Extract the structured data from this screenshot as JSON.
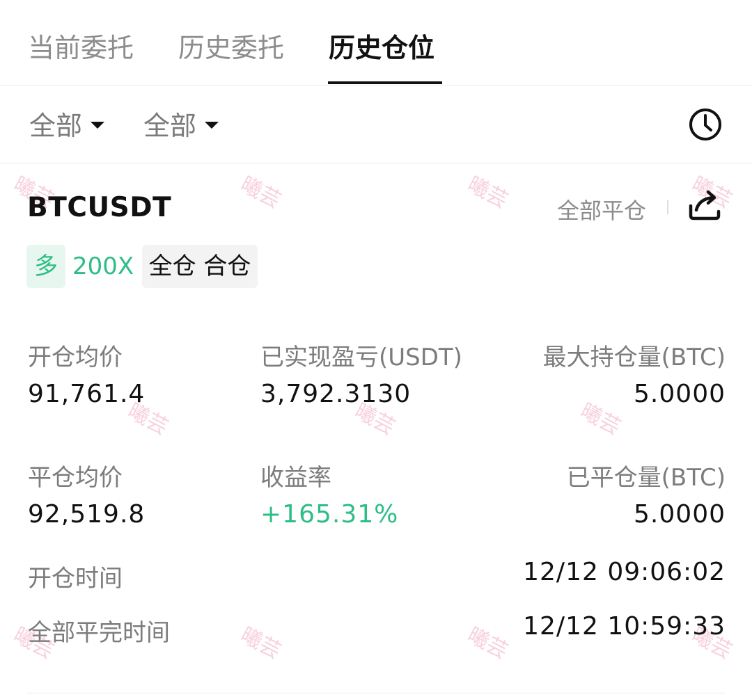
{
  "tabs": [
    {
      "label": "当前委托",
      "active": false
    },
    {
      "label": "历史委托",
      "active": false
    },
    {
      "label": "历史仓位",
      "active": true
    }
  ],
  "filters": [
    {
      "label": "全部"
    },
    {
      "label": "全部"
    }
  ],
  "icons": {
    "history": "clock-history-icon",
    "share": "share-icon",
    "dropdown": "caret-down-icon"
  },
  "watermark_text": "曦芸",
  "position": {
    "symbol": "BTCUSDT",
    "close_all_label": "全部平仓",
    "side_tag": "多",
    "leverage": "200X",
    "margin_mode": "全仓 合仓",
    "fields": {
      "open_avg_label": "开仓均价",
      "open_avg_value": "91,761.4",
      "realized_pnl_label": "已实现盈亏(USDT)",
      "realized_pnl_value": "3,792.3130",
      "max_hold_label": "最大持仓量(BTC)",
      "max_hold_value": "5.0000",
      "close_avg_label": "平仓均价",
      "close_avg_value": "92,519.8",
      "roi_label": "收益率",
      "roi_value": "+165.31%",
      "closed_qty_label": "已平仓量(BTC)",
      "closed_qty_value": "5.0000",
      "open_time_label": "开仓时间",
      "open_time_value": "12/12 09:06:02",
      "close_time_label": "全部平完时间",
      "close_time_value": "12/12 10:59:33"
    }
  },
  "colors": {
    "accent_green": "#2dbd85",
    "text_primary": "#111111",
    "text_secondary": "#7c7c7c",
    "watermark": "#e45882"
  }
}
